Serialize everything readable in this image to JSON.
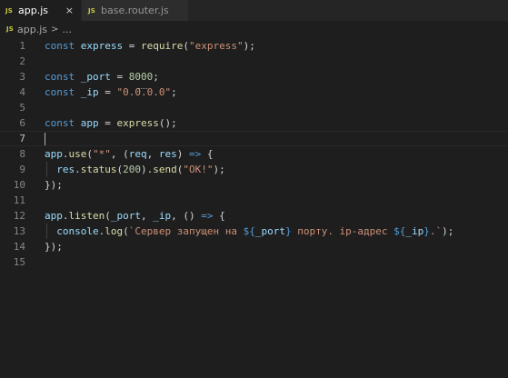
{
  "tabs": [
    {
      "icon": "JS",
      "label": "app.js",
      "close": "×",
      "active": true
    },
    {
      "icon": "JS",
      "label": "base.router.js",
      "active": false
    }
  ],
  "breadcrumb": {
    "icon": "JS",
    "file": "app.js",
    "separator": ">",
    "more": "..."
  },
  "editor": {
    "current_line": 7,
    "lines": [
      {
        "n": "1",
        "tokens": [
          [
            "kw",
            "const"
          ],
          [
            "punc",
            " "
          ],
          [
            "var",
            "express"
          ],
          [
            "punc",
            " = "
          ],
          [
            "fn",
            "require"
          ],
          [
            "punc",
            "("
          ],
          [
            "str",
            "\"express\""
          ],
          [
            "punc",
            ");"
          ]
        ]
      },
      {
        "n": "2",
        "tokens": []
      },
      {
        "n": "3",
        "tokens": [
          [
            "kw",
            "const"
          ],
          [
            "punc",
            " "
          ],
          [
            "var",
            "_port"
          ],
          [
            "punc",
            " = "
          ],
          [
            "num",
            "8000"
          ],
          [
            "punc",
            ";"
          ]
        ]
      },
      {
        "n": "4",
        "tokens": [
          [
            "kw",
            "const"
          ],
          [
            "punc",
            " "
          ],
          [
            "var",
            "_ip"
          ],
          [
            "punc",
            " = "
          ],
          [
            "str",
            "\"0.0.0.0\""
          ],
          [
            "punc",
            ";"
          ]
        ]
      },
      {
        "n": "5",
        "tokens": []
      },
      {
        "n": "6",
        "tokens": [
          [
            "kw",
            "const"
          ],
          [
            "punc",
            " "
          ],
          [
            "var",
            "app"
          ],
          [
            "punc",
            " = "
          ],
          [
            "fn",
            "express"
          ],
          [
            "punc",
            "();"
          ]
        ]
      },
      {
        "n": "7",
        "tokens": []
      },
      {
        "n": "8",
        "tokens": [
          [
            "var",
            "app"
          ],
          [
            "punc",
            "."
          ],
          [
            "fn",
            "use"
          ],
          [
            "punc",
            "("
          ],
          [
            "str",
            "\"*\""
          ],
          [
            "punc",
            ", ("
          ],
          [
            "var",
            "req"
          ],
          [
            "punc",
            ", "
          ],
          [
            "var",
            "res"
          ],
          [
            "punc",
            ") "
          ],
          [
            "kw",
            "=>"
          ],
          [
            "punc",
            " {"
          ]
        ]
      },
      {
        "n": "9",
        "tokens": [
          [
            "punc",
            "  "
          ],
          [
            "var",
            "res"
          ],
          [
            "punc",
            "."
          ],
          [
            "fn",
            "status"
          ],
          [
            "punc",
            "("
          ],
          [
            "num",
            "200"
          ],
          [
            "punc",
            ")."
          ],
          [
            "fn",
            "send"
          ],
          [
            "punc",
            "("
          ],
          [
            "str",
            "\"OK!\""
          ],
          [
            "punc",
            ");"
          ]
        ]
      },
      {
        "n": "10",
        "tokens": [
          [
            "punc",
            "});"
          ]
        ]
      },
      {
        "n": "11",
        "tokens": []
      },
      {
        "n": "12",
        "tokens": [
          [
            "var",
            "app"
          ],
          [
            "punc",
            "."
          ],
          [
            "fn",
            "listen"
          ],
          [
            "punc",
            "("
          ],
          [
            "var",
            "_port"
          ],
          [
            "punc",
            ", "
          ],
          [
            "var",
            "_ip"
          ],
          [
            "punc",
            ", () "
          ],
          [
            "kw",
            "=>"
          ],
          [
            "punc",
            " {"
          ]
        ]
      },
      {
        "n": "13",
        "tokens": [
          [
            "punc",
            "  "
          ],
          [
            "var",
            "console"
          ],
          [
            "punc",
            "."
          ],
          [
            "fn",
            "log"
          ],
          [
            "punc",
            "("
          ],
          [
            "str",
            "`Сервер запущен на "
          ],
          [
            "kw",
            "${"
          ],
          [
            "var",
            "_port"
          ],
          [
            "kw",
            "}"
          ],
          [
            "str",
            " порту. ip-адрес "
          ],
          [
            "kw",
            "${"
          ],
          [
            "var",
            "_ip"
          ],
          [
            "kw",
            "}"
          ],
          [
            "str",
            ".`"
          ],
          [
            "punc",
            ");"
          ]
        ]
      },
      {
        "n": "14",
        "tokens": [
          [
            "punc",
            "});"
          ]
        ]
      },
      {
        "n": "15",
        "tokens": []
      }
    ]
  },
  "colors": {
    "background": "#1e1e1e",
    "tabbar": "#252526",
    "keyword": "#569cd6",
    "variable": "#9cdcfe",
    "function": "#dcdcaa",
    "string": "#ce9178",
    "number": "#b5cea8",
    "js_icon": "#cbcb41"
  }
}
